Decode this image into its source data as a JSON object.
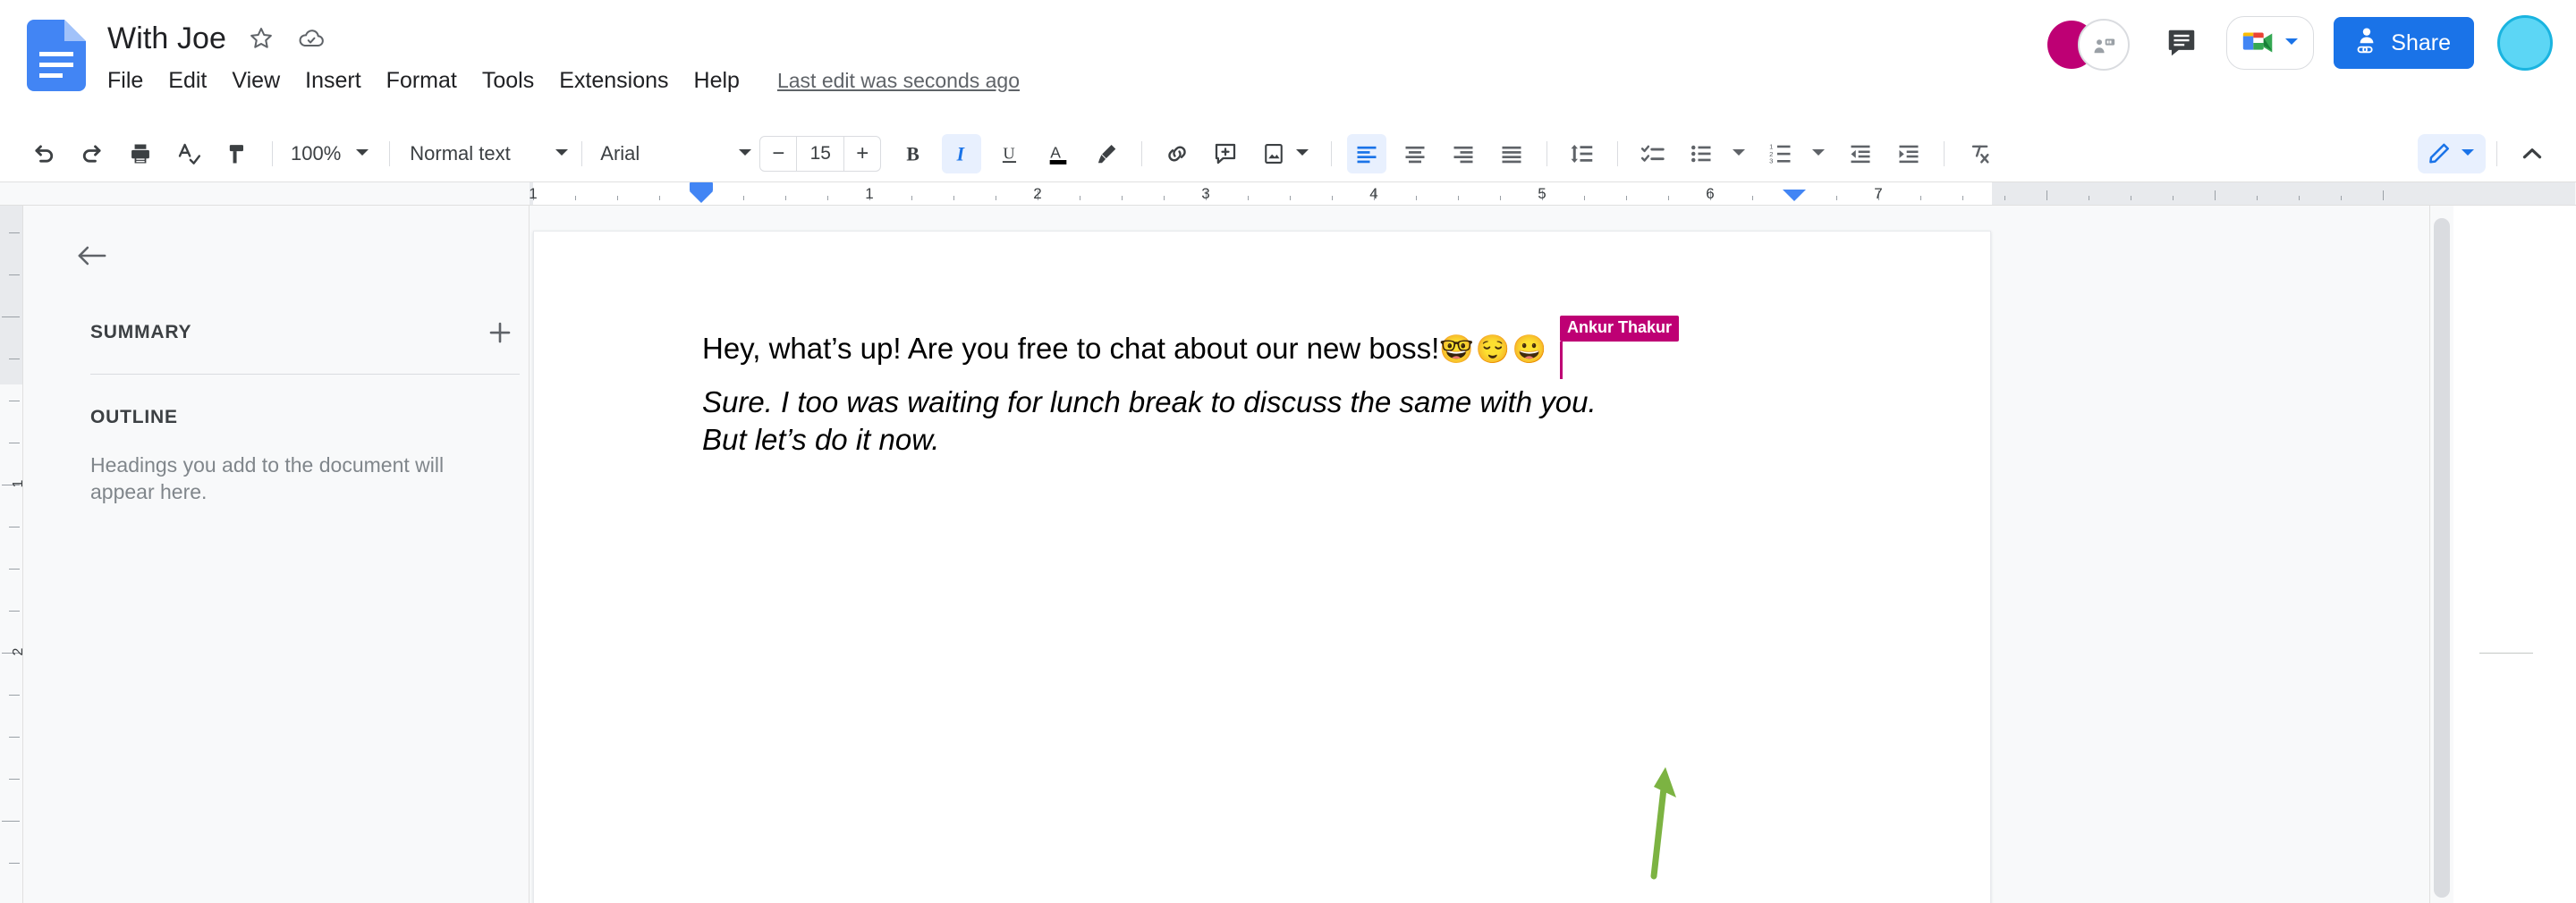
{
  "header": {
    "doc_title": "With Joe",
    "star_icon": "star-outline-icon",
    "cloud_icon": "cloud-saved-icon",
    "menu": [
      "File",
      "Edit",
      "View",
      "Insert",
      "Format",
      "Tools",
      "Extensions",
      "Help"
    ],
    "last_edit": "Last edit was seconds ago",
    "share_label": "Share",
    "colors": {
      "collaborator_magenta": "#be0074",
      "user_avatar_cyan": "#5cd6f5",
      "share_blue": "#1a73e8"
    },
    "icons": {
      "comment_history": "comment-icon",
      "meet": "google-meet-icon",
      "meet_caret": "chevron-down-icon",
      "share_person": "person-link-icon",
      "anon_collaborator": "anonymous-user-icon"
    }
  },
  "toolbar": {
    "undo": "undo-icon",
    "redo": "redo-icon",
    "print": "print-icon",
    "spellcheck": "spellcheck-icon",
    "paint_format": "paint-format-icon",
    "zoom_value": "100%",
    "style_value": "Normal text",
    "font_value": "Arial",
    "font_size": "15",
    "decrease_label": "−",
    "increase_label": "+",
    "bold": "B",
    "italic": "I",
    "underline": "U",
    "text_color": "A",
    "highlight": "highlighter-icon",
    "insert_link": "link-icon",
    "add_comment": "add-comment-icon",
    "insert_image": "insert-image-icon",
    "align_left": "align-left-icon",
    "align_center": "align-center-icon",
    "align_right": "align-right-icon",
    "align_justify": "align-justify-icon",
    "line_spacing": "line-spacing-icon",
    "checklist": "checklist-icon",
    "bulleted_list": "bulleted-list-icon",
    "numbered_list": "numbered-list-icon",
    "decrease_indent": "decrease-indent-icon",
    "increase_indent": "increase-indent-icon",
    "clear_formatting": "clear-formatting-icon",
    "edit_mode": "pencil-edit-icon",
    "collapse_toolbar": "chevron-up-icon",
    "active": [
      "italic",
      "align_left",
      "edit_mode"
    ]
  },
  "ruler": {
    "horizontal_numbers": [
      "1",
      "1",
      "2",
      "3",
      "4",
      "5",
      "6",
      "7"
    ],
    "vertical_numbers": [
      "1",
      "1",
      "2"
    ],
    "indent_marker": "left-indent-marker"
  },
  "sidebar": {
    "back_icon": "back-arrow-icon",
    "summary_title": "SUMMARY",
    "add_summary_icon": "plus-icon",
    "outline_title": "OUTLINE",
    "outline_empty_text": "Headings you add to the document will appear here."
  },
  "document": {
    "paragraph1_text": "Hey, what’s up! Are you free to chat about our new boss!",
    "paragraph1_emojis": "🤓😌😀",
    "paragraph2_line1": "Sure. I too was waiting for lunch break to discuss the same with you.",
    "paragraph2_line2": "But let’s do it now.",
    "collaborator_name": "Ankur Thakur",
    "annotation": {
      "type": "green-arrow",
      "color": "#7cb342"
    }
  }
}
